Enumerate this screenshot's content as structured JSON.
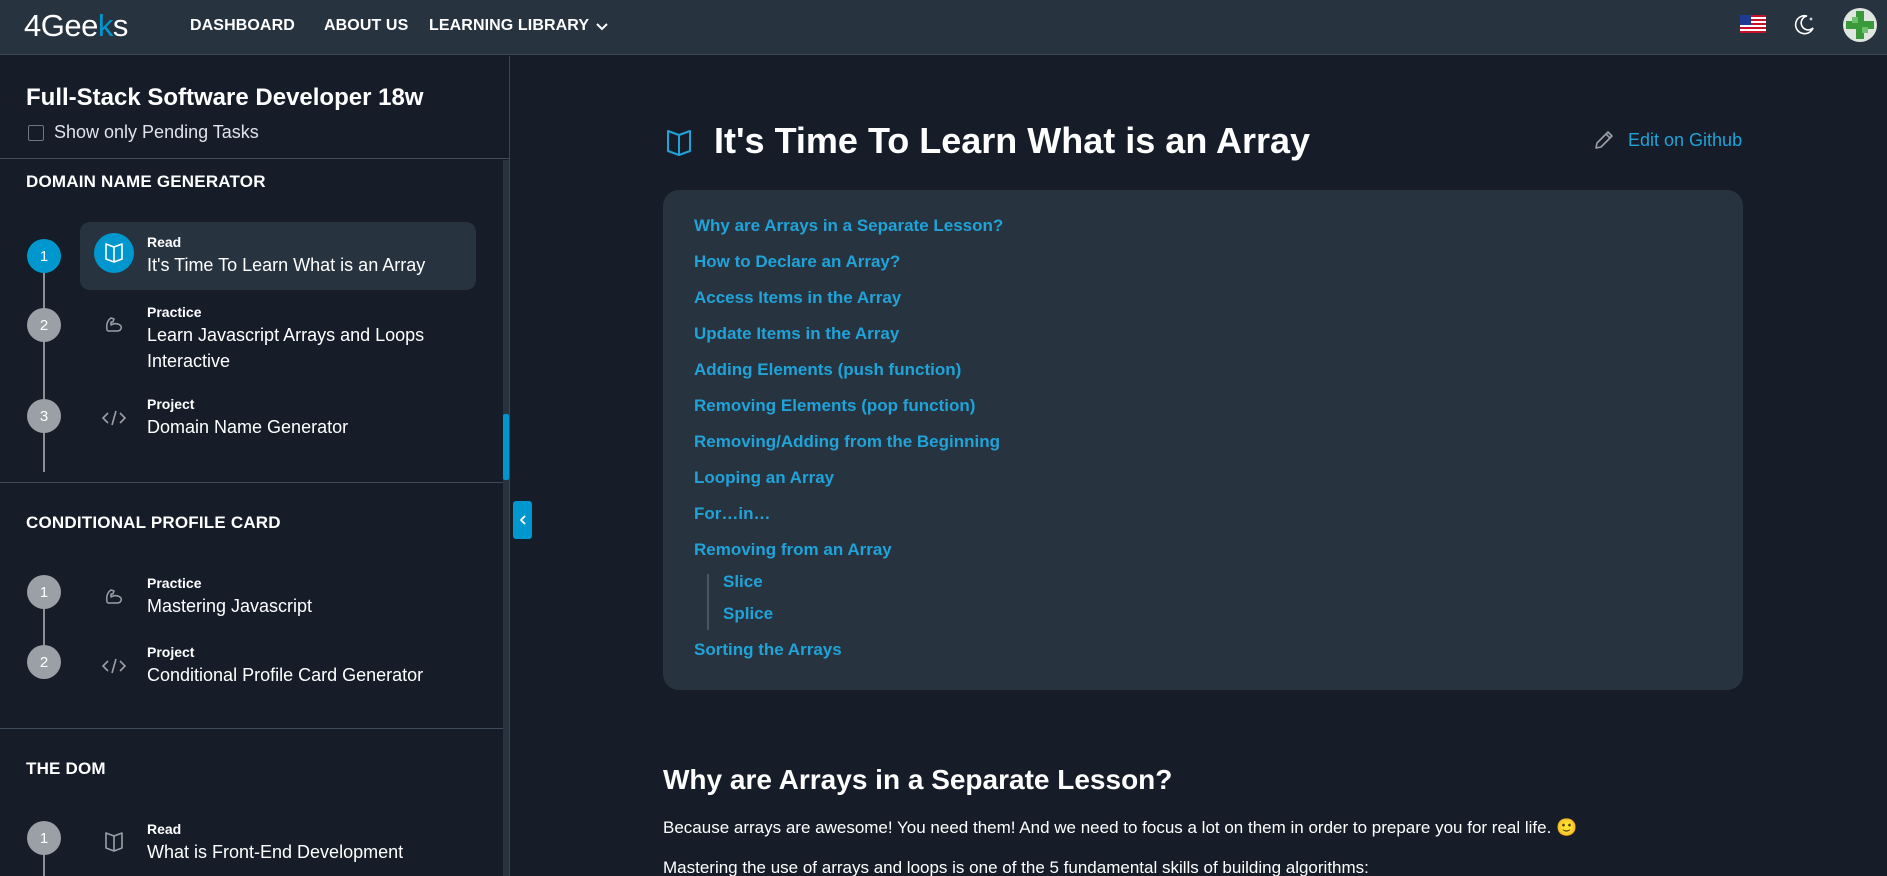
{
  "navbar": {
    "logo_main": "4Gee",
    "logo_accent": "k",
    "logo_end": "s",
    "links": [
      "DASHBOARD",
      "ABOUT US",
      "LEARNING LIBRARY"
    ]
  },
  "sidebar": {
    "course_title": "Full-Stack Software Developer 18w",
    "pending_label": "Show only Pending Tasks",
    "modules": [
      {
        "title": "DOMAIN NAME GENERATOR",
        "steps": [
          {
            "num": "1",
            "type": "Read",
            "name": "It's Time To Learn What is an Array"
          },
          {
            "num": "2",
            "type": "Practice",
            "name": "Learn Javascript Arrays and Loops Interactive"
          },
          {
            "num": "3",
            "type": "Project",
            "name": "Domain Name Generator"
          }
        ]
      },
      {
        "title": "CONDITIONAL PROFILE CARD",
        "steps": [
          {
            "num": "1",
            "type": "Practice",
            "name": "Mastering Javascript"
          },
          {
            "num": "2",
            "type": "Project",
            "name": "Conditional Profile Card Generator"
          }
        ]
      },
      {
        "title": "THE DOM",
        "steps": [
          {
            "num": "1",
            "type": "Read",
            "name": "What is Front-End Development"
          }
        ]
      }
    ]
  },
  "main": {
    "title": "It's Time To Learn What is an Array",
    "edit_label": "Edit on Github",
    "toc": [
      "Why are Arrays in a Separate Lesson?",
      "How to Declare an Array?",
      "Access Items in the Array",
      "Update Items in the Array",
      "Adding Elements (push function)",
      "Removing Elements (pop function)",
      "Removing/Adding from the Beginning",
      "Looping an Array",
      "For…in…",
      "Removing from an Array"
    ],
    "toc_sub": [
      "Slice",
      "Splice"
    ],
    "toc_last": "Sorting the Arrays",
    "section_heading": "Why are Arrays in a Separate Lesson?",
    "para1": "Because arrays are awesome! You need them! And we need to focus a lot on them in order to prepare you for real life. 🙂",
    "para2": "Mastering the use of arrays and loops is one of the 5 fundamental skills of building algorithms:"
  },
  "colors": {
    "accent": "#0097cf",
    "link": "#1fa3d8",
    "background": "#161d29",
    "panel": "#283340"
  }
}
